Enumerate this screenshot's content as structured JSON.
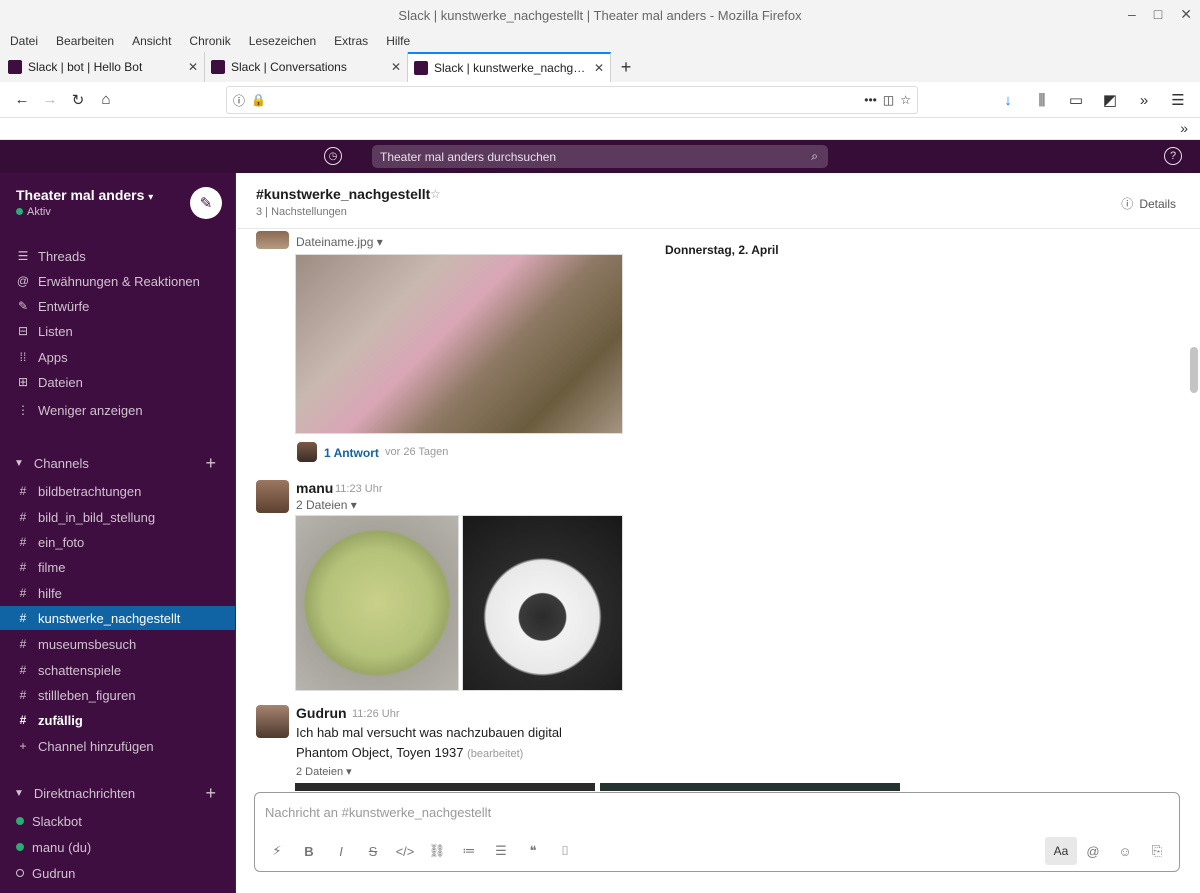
{
  "browser": {
    "window_title": "Slack | kunstwerke_nachgestellt | Theater mal anders - Mozilla Firefox",
    "menu": [
      "Datei",
      "Bearbeiten",
      "Ansicht",
      "Chronik",
      "Lesezeichen",
      "Extras",
      "Hilfe"
    ],
    "tabs": [
      {
        "title": "Slack | bot | Hello Bot"
      },
      {
        "title": "Slack | Conversations"
      },
      {
        "title": "Slack | kunstwerke_nachgestellt"
      }
    ],
    "url": ""
  },
  "slack": {
    "search_placeholder": "Theater mal anders durchsuchen",
    "workspace": {
      "name": "Theater mal anders",
      "status": "Aktiv"
    },
    "nav": [
      {
        "icon": "threads-icon",
        "glyph": "☰",
        "label": "Threads"
      },
      {
        "icon": "at-icon",
        "glyph": "@",
        "label": "Erwähnungen & Reaktionen"
      },
      {
        "icon": "drafts-icon",
        "glyph": "✎",
        "label": "Entwürfe"
      },
      {
        "icon": "saved-icon",
        "glyph": "⊟",
        "label": "Listen"
      },
      {
        "icon": "apps-icon",
        "glyph": "⁞⁞",
        "label": "Apps"
      },
      {
        "icon": "files-icon",
        "glyph": "⊞",
        "label": "Dateien"
      },
      {
        "icon": "more-icon",
        "glyph": "⋮",
        "label": "Weniger anzeigen"
      }
    ],
    "channels_header": "Channels",
    "channels": [
      {
        "name": "bildbetrachtungen",
        "state": "normal"
      },
      {
        "name": "bild_in_bild_stellung",
        "state": "normal"
      },
      {
        "name": "ein_foto",
        "state": "normal"
      },
      {
        "name": "filme",
        "state": "normal"
      },
      {
        "name": "hilfe",
        "state": "normal"
      },
      {
        "name": "kunstwerke_nachgestellt",
        "state": "active"
      },
      {
        "name": "museumsbesuch",
        "state": "normal"
      },
      {
        "name": "schattenspiele",
        "state": "normal"
      },
      {
        "name": "stillleben_figuren",
        "state": "normal"
      },
      {
        "name": "zufällig",
        "state": "bold"
      },
      {
        "name": "Channel hinzufügen",
        "state": "add"
      }
    ],
    "dm_header": "Direktnachrichten",
    "dms": [
      {
        "name": "Slackbot",
        "online": true
      },
      {
        "name": "manu (du)",
        "online": true
      },
      {
        "name": "Gudrun",
        "online": false
      }
    ],
    "channel": {
      "name": "#kunstwerke_nachgestellt",
      "meta": "3 | Nachstellungen",
      "details_label": "Details",
      "date": "Donnerstag, 2. April"
    },
    "messages": [
      {
        "user": "",
        "file_label": "Dateiname.jpg ▾",
        "reply_count": "1 Antwort",
        "reply_when": "vor 26 Tagen"
      },
      {
        "user": "manu",
        "time": "11:23 Uhr",
        "file_label": "2 Dateien ▾"
      },
      {
        "user": "Gudrun",
        "time": "11:26 Uhr",
        "text": "Ich hab mal versucht was nachzubauen digital",
        "text2": "Phantom Object, Toyen 1937",
        "edited": "(bearbeitet)",
        "file_label": "2 Dateien ▾"
      }
    ],
    "composer": {
      "placeholder": "Nachricht an #kunstwerke_nachgestellt",
      "aa": "Aa"
    }
  },
  "colors": {
    "sidebar": "#3f0e40",
    "topbar": "#350d36",
    "active_channel": "#1164a3",
    "online": "#2bac76"
  }
}
